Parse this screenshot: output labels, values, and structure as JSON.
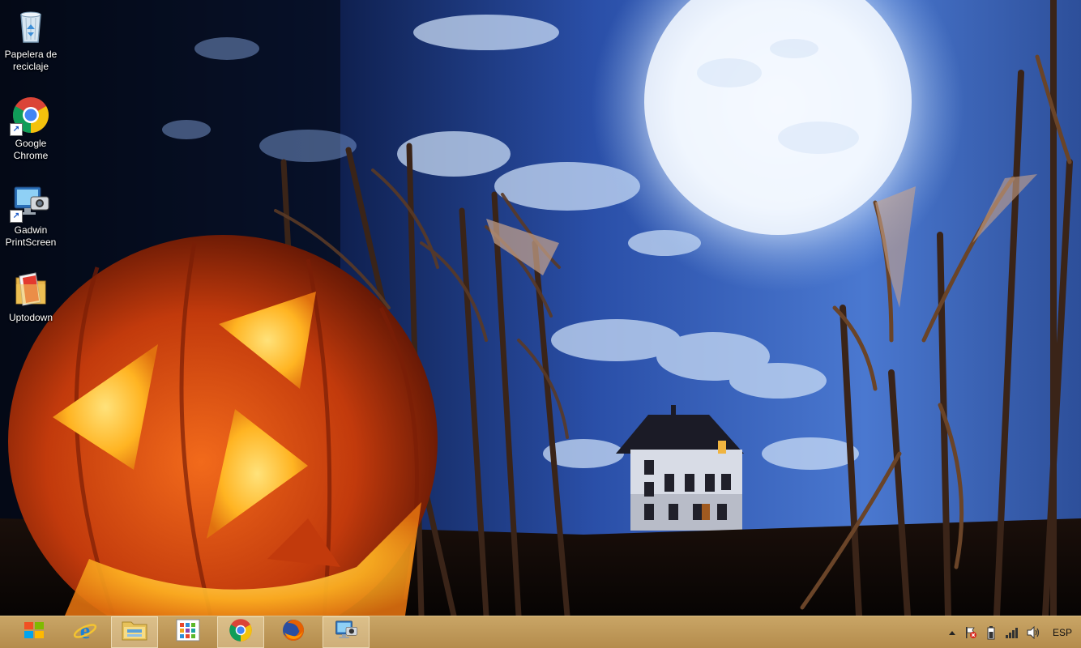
{
  "desktop": {
    "icons": [
      {
        "label": "Papelera de reciclaje",
        "icon": "recycle-bin-icon"
      },
      {
        "label": "Google Chrome",
        "icon": "chrome-icon"
      },
      {
        "label": "Gadwin PrintScreen",
        "icon": "gadwin-printscreen-icon"
      },
      {
        "label": "Uptodown",
        "icon": "uptodown-icon"
      }
    ],
    "wallpaper": "halloween-jack-o-lantern-haunted-house-full-moon"
  },
  "taskbar": {
    "color": "#c9a566",
    "pinned": [
      {
        "name": "start-button",
        "icon": "windows-logo-icon"
      },
      {
        "name": "internet-explorer",
        "icon": "internet-explorer-icon"
      },
      {
        "name": "file-explorer",
        "icon": "file-explorer-icon"
      },
      {
        "name": "start-screen",
        "icon": "start-screen-icon"
      },
      {
        "name": "google-chrome",
        "icon": "chrome-icon"
      },
      {
        "name": "firefox",
        "icon": "firefox-icon"
      },
      {
        "name": "gadwin-printscreen",
        "icon": "gadwin-printscreen-icon"
      }
    ],
    "tray": {
      "language": "ESP",
      "icons": [
        "show-hidden-icons-arrow",
        "action-center-flag-icon",
        "power-icon",
        "network-signal-icon",
        "volume-icon"
      ]
    }
  }
}
